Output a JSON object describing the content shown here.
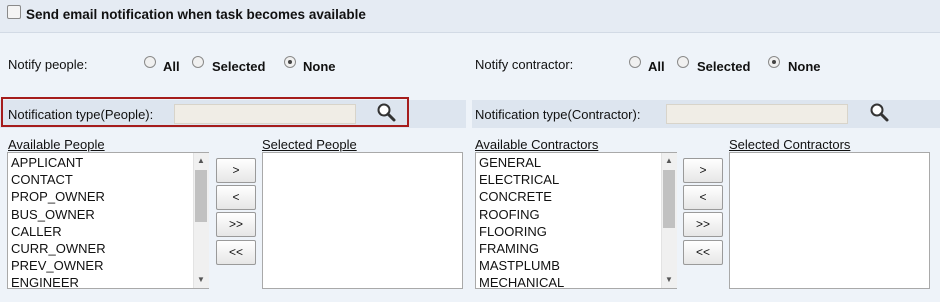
{
  "header": {
    "send_email_label": "Send email notification when task becomes available"
  },
  "notify_people": {
    "label": "Notify people:",
    "options": [
      "All",
      "Selected",
      "None"
    ],
    "selected": "None"
  },
  "notify_contractor": {
    "label": "Notify contractor:",
    "options": [
      "All",
      "Selected",
      "None"
    ],
    "selected": "None"
  },
  "people_type": {
    "label": "Notification type(People):",
    "value": ""
  },
  "contractor_type": {
    "label": "Notification type(Contractor):",
    "value": ""
  },
  "people_lists": {
    "available_label": "Available People",
    "selected_label": "Selected People",
    "available": [
      "APPLICANT",
      "CONTACT",
      "PROP_OWNER",
      "BUS_OWNER",
      "CALLER",
      "CURR_OWNER",
      "PREV_OWNER",
      "ENGINEER"
    ]
  },
  "contractor_lists": {
    "available_label": "Available Contractors",
    "selected_label": "Selected Contractors",
    "available": [
      "GENERAL",
      "ELECTRICAL",
      "CONCRETE",
      "ROOFING",
      "FLOORING",
      "FRAMING",
      "MASTPLUMB",
      "MECHANICAL"
    ]
  },
  "move_buttons": [
    ">",
    "<",
    ">>",
    "<<"
  ],
  "icons": {
    "search": "magnifier-icon",
    "scroll_up": "triangle-up",
    "scroll_down": "triangle-down"
  }
}
